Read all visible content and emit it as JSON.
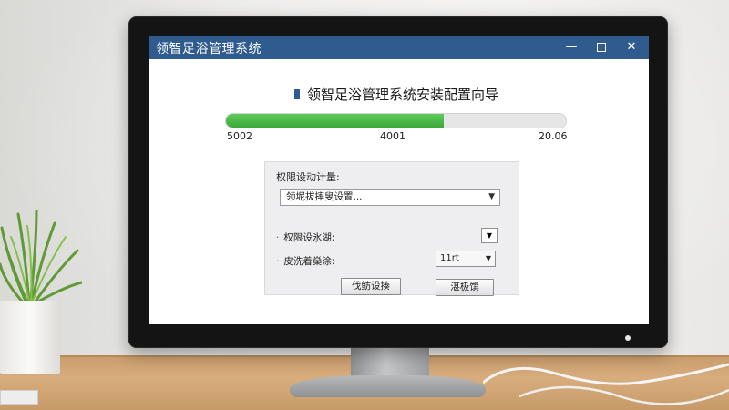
{
  "window": {
    "title": "领智足浴管理系统",
    "minimize_glyph": "—",
    "close_glyph": "✕"
  },
  "wizard": {
    "heading": "领智足浴管理系统安装配置向导",
    "progress": {
      "fraction": 0.64,
      "label_left": "5002",
      "label_mid": "4001",
      "label_right": "20.06"
    }
  },
  "panel": {
    "title": "权限设动计量:",
    "main_select_value": "领坭拔摔叟设置...",
    "row1_label": "权限设氷湖:",
    "row2_label": "皮洗着燊涂:",
    "row2_select_value": "11rt",
    "button_left": "伐鲂设揍",
    "button_right": "湛极馔"
  },
  "colors": {
    "titlebar": "#2f5b8f",
    "progress": "#4cbb48"
  }
}
